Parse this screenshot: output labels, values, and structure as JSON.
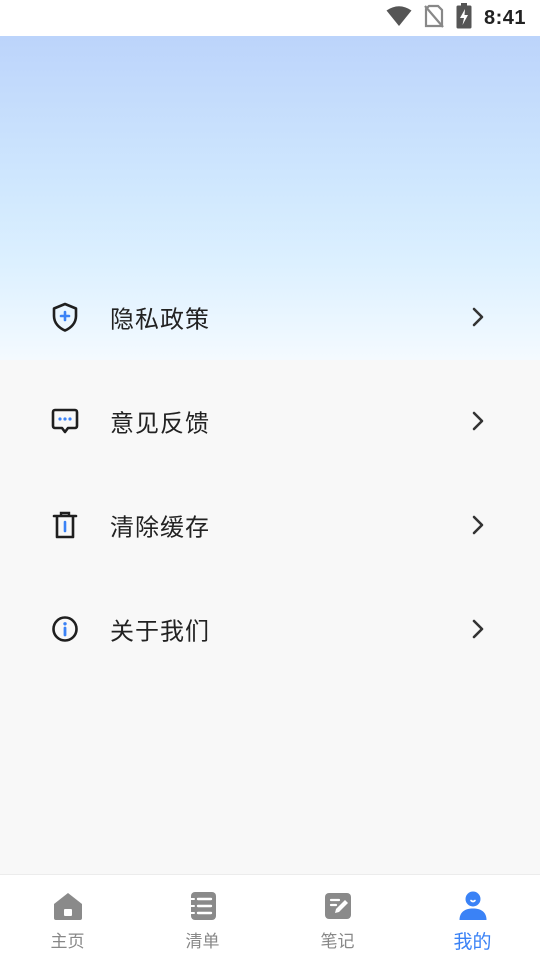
{
  "status_bar": {
    "time": "8:41",
    "icons": [
      "wifi-icon",
      "no-sim-icon",
      "battery-charging-icon"
    ]
  },
  "menu": {
    "items": [
      {
        "label": "隐私政策",
        "icon": "shield-plus-icon"
      },
      {
        "label": "意见反馈",
        "icon": "message-dots-icon"
      },
      {
        "label": "清除缓存",
        "icon": "trash-icon"
      },
      {
        "label": "关于我们",
        "icon": "info-icon"
      }
    ]
  },
  "bottom_nav": {
    "items": [
      {
        "label": "主页",
        "icon": "home-icon",
        "active": false
      },
      {
        "label": "清单",
        "icon": "list-icon",
        "active": false
      },
      {
        "label": "笔记",
        "icon": "note-edit-icon",
        "active": false
      },
      {
        "label": "我的",
        "icon": "user-icon",
        "active": true
      }
    ]
  },
  "colors": {
    "accent": "#3a82f6",
    "nav_inactive": "#888888",
    "icon_dark": "#1f1f1f",
    "header_top": "#bcd4fb",
    "header_bottom": "#f4faff",
    "background": "#f8f8f8"
  }
}
